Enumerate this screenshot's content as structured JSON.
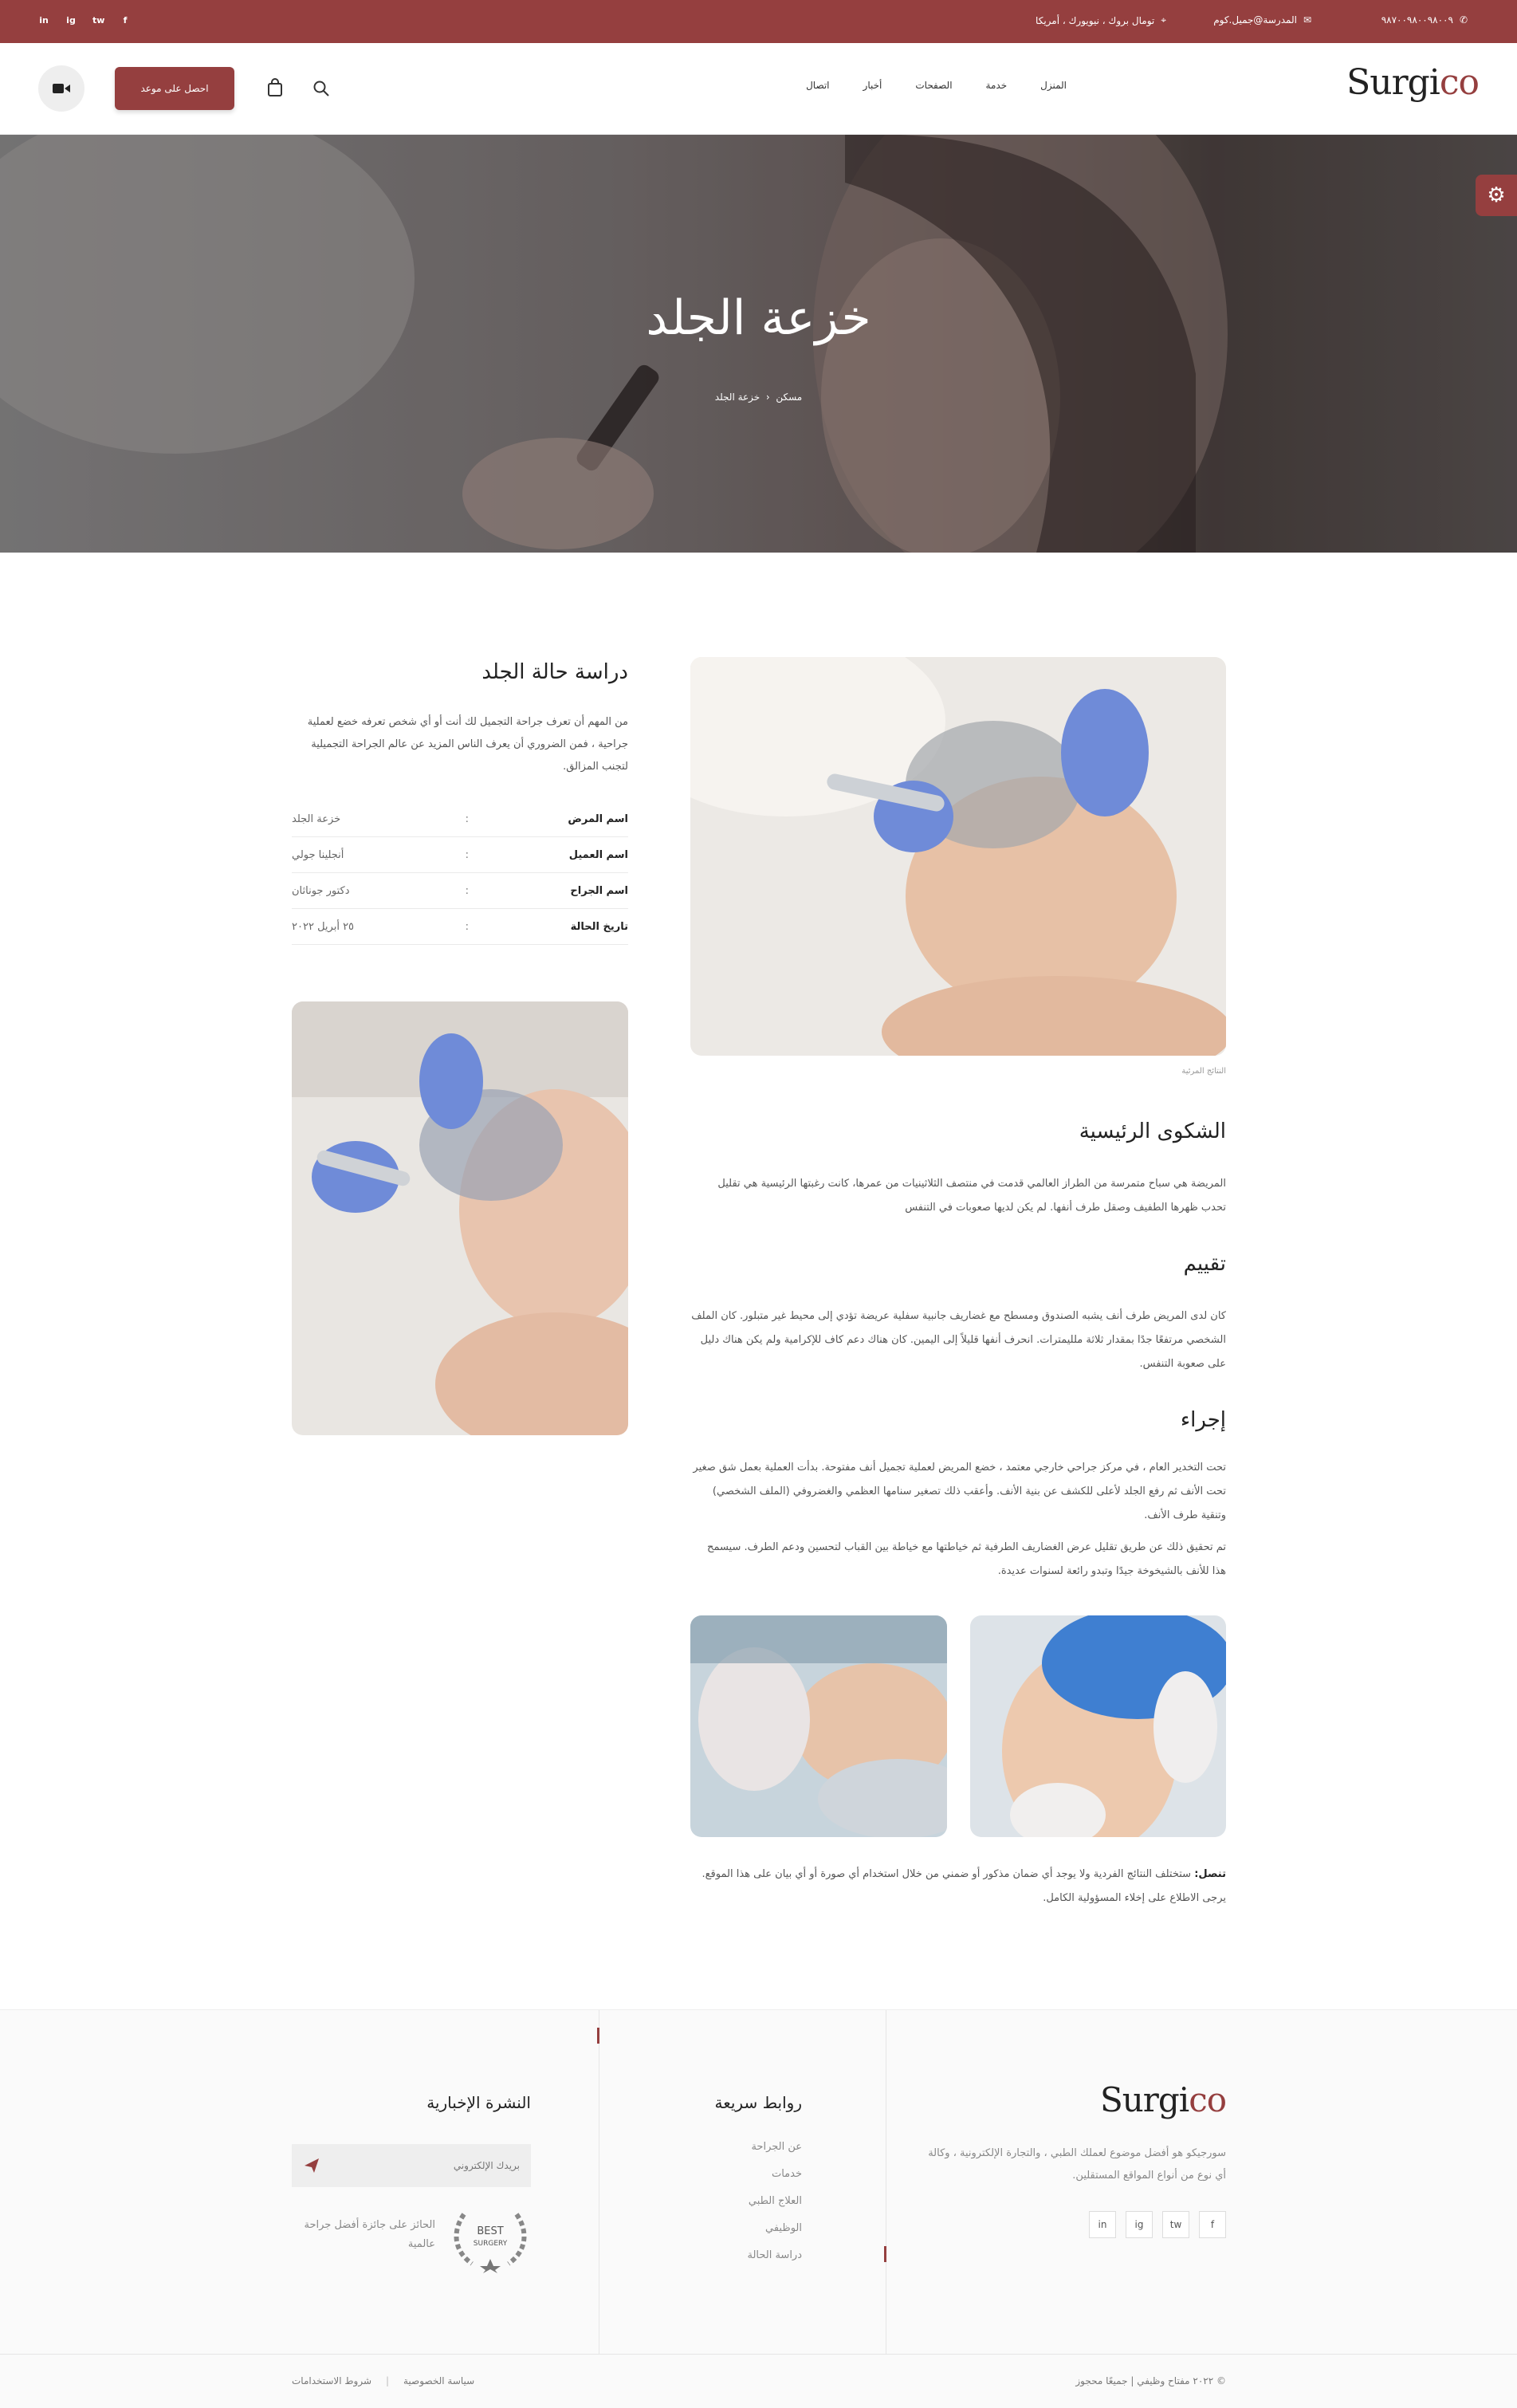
{
  "topbar": {
    "phone": "٩٨٧٠٠٩٨٠٠٩٨٠٠٩",
    "email": "المدرسة@جميل.كوم",
    "address": "تومال بروك ، نيويورك ، أمريكا",
    "social": [
      "in",
      "ig",
      "tw",
      "f"
    ]
  },
  "header": {
    "logo_main": "Surgi",
    "logo_accent": "co",
    "nav": [
      "المنزل",
      "خدمة",
      "الصفحات",
      "أخبار",
      "اتصال"
    ],
    "appointment_label": "احصل على موعد"
  },
  "hero": {
    "title": "خزعة الجلد",
    "breadcrumb_home": "مسكن",
    "breadcrumb_current": "خزعة الجلد"
  },
  "study": {
    "title": "دراسة حالة الجلد",
    "intro": "من المهم أن تعرف جراحة التجميل لك أنت أو أي شخص تعرفه خضع لعملية جراحية ، فمن الضروري أن يعرف الناس المزيد عن عالم الجراحة التجميلية لتجنب المزالق.",
    "rows": [
      {
        "key": "اسم المرض",
        "sep": ":",
        "value": "خزعة الجلد"
      },
      {
        "key": "اسم العميل",
        "sep": ":",
        "value": "أنجلينا جولي"
      },
      {
        "key": "اسم الجراح",
        "sep": ":",
        "value": "دكتور جوناثان"
      },
      {
        "key": "تاريخ الحالة",
        "sep": ":",
        "value": "٢٥ أبريل ٢٠٢٢"
      }
    ]
  },
  "main": {
    "caption": "النتائج المرئية",
    "sections": [
      {
        "title": "الشكوى الرئيسية",
        "text": "المريضة هي سباح متمرسة من الطراز العالمي قدمت في منتصف الثلاثينيات من عمرها، كانت رغبتها الرئيسية هي تقليل تحدب ظهرها الطفيف وصقل طرف أنفها. لم يكن لديها صعوبات في التنفس"
      },
      {
        "title": "تقييم",
        "text": "كان لدى المريض طرف أنف يشبه الصندوق ومسطح مع غضاريف جانبية سفلية عريضة تؤدي إلى محيط غير متبلور. كان الملف الشخصي مرتفعًا جدًا بمقدار ثلاثة ملليمترات. انحرف أنفها قليلاً إلى اليمين. كان هناك دعم كاف للإكرامية ولم يكن هناك دليل على صعوبة التنفس."
      },
      {
        "title": "إجراء",
        "text": "تحت التخدير العام ، في مركز جراحي خارجي معتمد ، خضع المريض لعملية تجميل أنف مفتوحة. بدأت العملية بعمل شق صغير تحت الأنف ثم رفع الجلد لأعلى للكشف عن بنية الأنف. وأعقب ذلك تصغير سنامها العظمي والغضروفي (الملف الشخصي) وتنقية طرف الأنف.",
        "text2": "تم تحقيق ذلك عن طريق تقليل عرض الغضاريف الطرفية ثم خياطتها مع خياطة بين القباب لتحسين ودعم الطرف. سيسمح هذا للأنف بالشيخوخة جيدًا وتبدو رائعة لسنوات عديدة."
      }
    ],
    "note_label": "تنصل:",
    "note_text": "ستختلف النتائج الفردية ولا يوجد أي ضمان مذكور أو ضمني من خلال استخدام أي صورة أو أي بيان على هذا الموقع. يرجى الاطلاع على إخلاء المسؤولية الكامل."
  },
  "footer": {
    "logo_main": "Surgi",
    "logo_accent": "co",
    "about": "سورجيكو هو أفضل موضوع لعملك الطبي ، والتجارة الإلكترونية ، وكالة أي نوع من أنواع المواقع المستقلين.",
    "social": [
      "f",
      "tw",
      "ig",
      "in"
    ],
    "links_title": "روابط سريعة",
    "links": [
      "عن الجراحة",
      "خدمات",
      "العلاج الطبي",
      "الوظيفي",
      "دراسة الحالة"
    ],
    "newsletter_title": "النشرة الإخبارية",
    "email_placeholder": "بريدك الإلكتروني",
    "award_text": "الحائز على جائزة أفضل جراحة عالمية",
    "award_badge_line1": "BEST",
    "award_badge_line2": "SURGERY",
    "copyright": "© ٢٠٢٢ مفتاح وظيفي | جميعًا محجوز",
    "bottom_links": [
      "سياسة الخصوصية",
      "شروط الاستخدامات"
    ]
  },
  "colors": {
    "accent": "#953f3f",
    "text": "#333333"
  }
}
